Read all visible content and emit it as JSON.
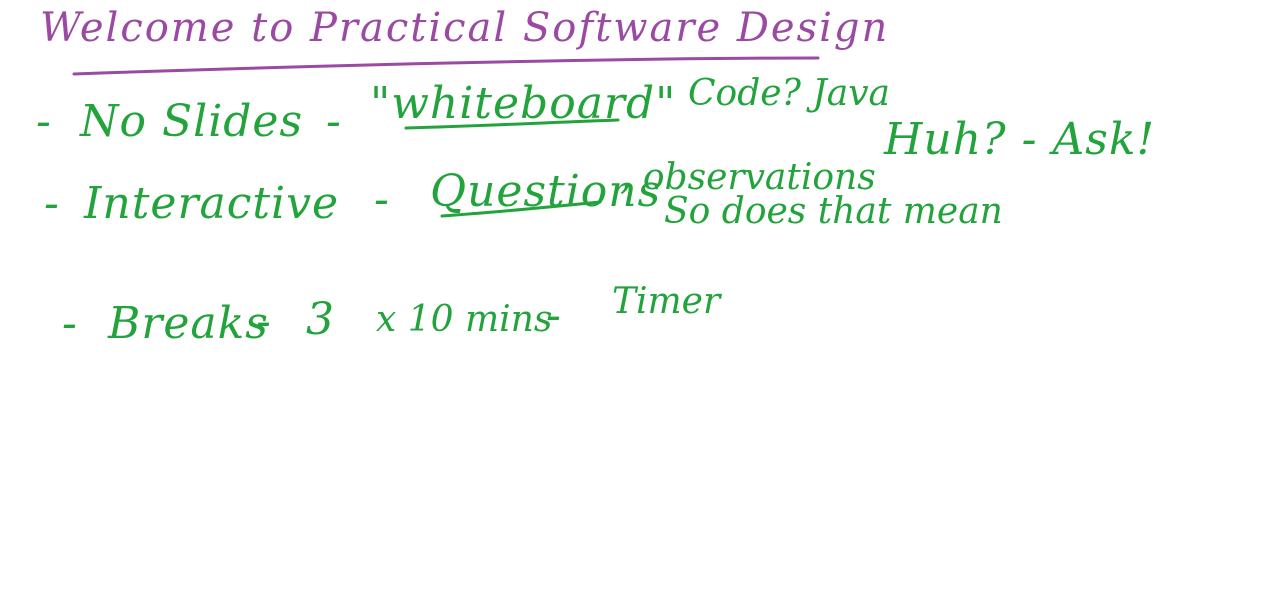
{
  "colors": {
    "title_ink": "#9b4aa3",
    "body_ink": "#22a33c",
    "background": "#ffffff"
  },
  "title": "Welcome to Practical Software Design",
  "lines": {
    "slides": {
      "bullet": "-",
      "label": "No Slides",
      "dash": "-",
      "quote": "\"whiteboard\"",
      "code": "Code? Java"
    },
    "interactive": {
      "bullet": "-",
      "label": "Interactive",
      "dash": "-",
      "questions": "Questions",
      "observations": ", observations",
      "huh": "Huh? - Ask!",
      "meaning": "So does that mean"
    },
    "breaks": {
      "bullet": "-",
      "label": "Breaks",
      "dash": "-",
      "count": "3",
      "times": "x 10 mins",
      "dash2": "-",
      "timer": "Timer"
    }
  }
}
